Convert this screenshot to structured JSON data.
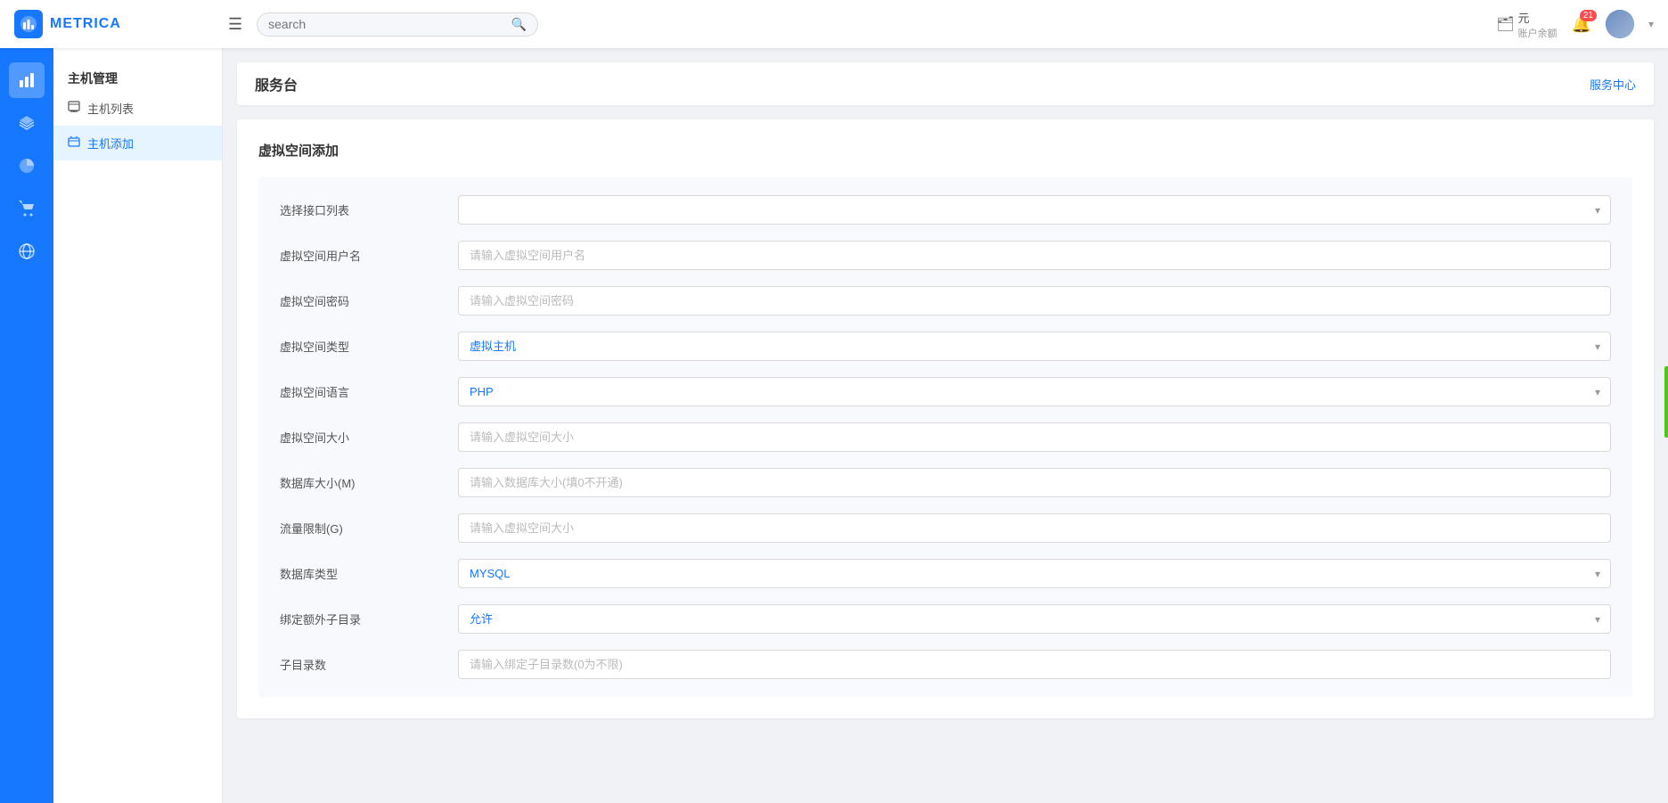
{
  "header": {
    "logo_text": "METRICA",
    "search_placeholder": "search",
    "account_label": "元",
    "account_sublabel": "账户余额",
    "notification_count": "21",
    "menu_icon": "☰"
  },
  "icon_sidebar": {
    "items": [
      {
        "icon": "📊",
        "name": "analytics-icon",
        "active": true
      },
      {
        "icon": "🗂",
        "name": "files-icon"
      },
      {
        "icon": "🥧",
        "name": "pie-chart-icon"
      },
      {
        "icon": "🛒",
        "name": "cart-icon"
      },
      {
        "icon": "⚙",
        "name": "settings-icon"
      }
    ]
  },
  "nav_sidebar": {
    "section_title": "主机管理",
    "items": [
      {
        "label": "主机列表",
        "icon": "📋",
        "active": false
      },
      {
        "label": "主机添加",
        "icon": "📁",
        "active": true
      }
    ]
  },
  "page": {
    "breadcrumb_label": "服务台",
    "service_center_label": "服务中心",
    "form_title": "虚拟空间添加",
    "fields": {
      "interface_list_label": "选择接口列表",
      "interface_list_placeholder": "",
      "username_label": "虚拟空间用户名",
      "username_placeholder": "请输入虚拟空间用户名",
      "password_label": "虚拟空间密码",
      "password_placeholder": "请输入虚拟空间密码",
      "type_label": "虚拟空间类型",
      "type_value": "虚拟主机",
      "language_label": "虚拟空间语言",
      "language_value": "PHP",
      "size_label": "虚拟空间大小",
      "size_placeholder": "请输入虚拟空间大小",
      "db_size_label": "数据库大小(M)",
      "db_size_placeholder": "请输入数据库大小(填0不开通)",
      "traffic_label": "流量限制(G)",
      "traffic_placeholder": "请输入虚拟空间大小",
      "db_type_label": "数据库类型",
      "db_type_value": "MYSQL",
      "subdir_label": "绑定额外子目录",
      "subdir_value": "允许",
      "subdir_count_label": "子目录数",
      "subdir_count_placeholder": "请输入绑定子目录数(0为不限)"
    }
  }
}
